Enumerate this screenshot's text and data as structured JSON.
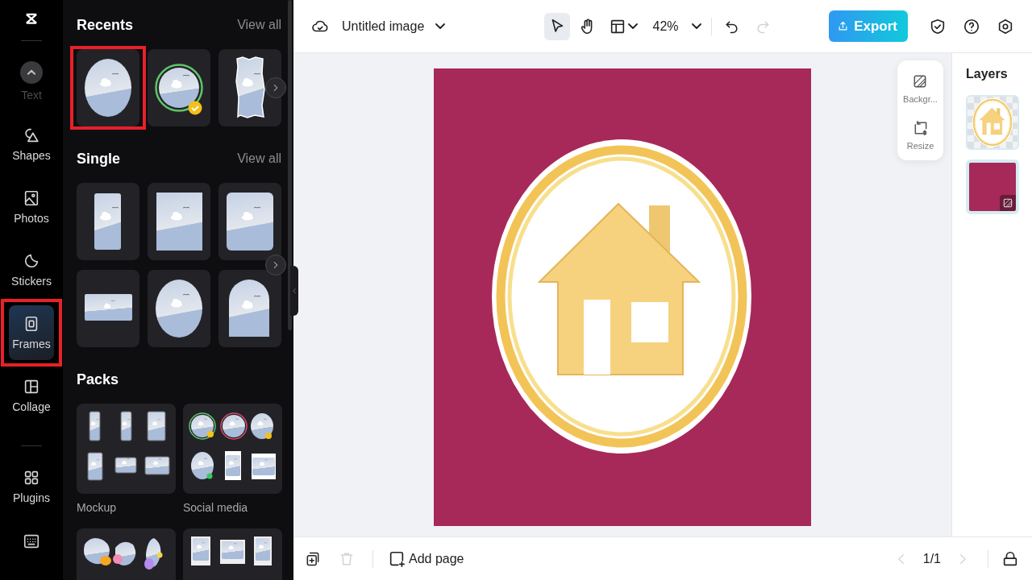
{
  "rail": {
    "groups": [
      {
        "items": [
          {
            "label": "Text",
            "kind": "text",
            "dimmed": true,
            "selected": false,
            "highlighted": false
          },
          {
            "label": "Shapes",
            "kind": "shapes",
            "dimmed": false,
            "selected": false,
            "highlighted": false
          },
          {
            "label": "Photos",
            "kind": "photos",
            "dimmed": false,
            "selected": false,
            "highlighted": false
          },
          {
            "label": "Stickers",
            "kind": "stickers",
            "dimmed": false,
            "selected": false,
            "highlighted": false
          },
          {
            "label": "Frames",
            "kind": "frames",
            "dimmed": false,
            "selected": true,
            "highlighted": true
          },
          {
            "label": "Collage",
            "kind": "collage",
            "dimmed": false,
            "selected": false,
            "highlighted": false
          }
        ]
      },
      {
        "items": [
          {
            "label": "Plugins",
            "kind": "plugins",
            "dimmed": false,
            "selected": false,
            "highlighted": false
          }
        ]
      }
    ]
  },
  "panel": {
    "sections": [
      {
        "title": "Recents",
        "link": "View all",
        "thumbs": [
          {
            "kind": "oval",
            "highlighted": true
          },
          {
            "kind": "ring-check",
            "highlighted": false
          },
          {
            "kind": "torn",
            "highlighted": false
          }
        ]
      },
      {
        "title": "Single",
        "link": "View all",
        "thumbs": [
          {
            "kind": "tall-rect",
            "highlighted": false
          },
          {
            "kind": "rect",
            "highlighted": false
          },
          {
            "kind": "rounded-rect",
            "highlighted": false
          },
          {
            "kind": "wide-rect",
            "highlighted": false
          },
          {
            "kind": "oval",
            "highlighted": false
          },
          {
            "kind": "arch",
            "highlighted": false
          }
        ]
      }
    ],
    "packs": {
      "title": "Packs",
      "items": [
        {
          "kind": "mockup",
          "label": "Mockup"
        },
        {
          "kind": "social",
          "label": "Social media"
        },
        {
          "kind": "blobs"
        },
        {
          "kind": "polaroid"
        }
      ]
    }
  },
  "top_bar": {
    "title": "Untitled image",
    "tools": [
      {
        "kind": "pointer",
        "selected": true
      },
      {
        "kind": "hand",
        "selected": false
      },
      {
        "kind": "layout",
        "selected": false
      }
    ],
    "zoom": "42%",
    "history": [
      {
        "kind": "undo",
        "disabled": false
      },
      {
        "kind": "redo",
        "disabled": true
      }
    ],
    "export": "Export"
  },
  "side_tools": [
    {
      "kind": "background",
      "label": "Backgr..."
    },
    {
      "kind": "resize",
      "label": "Resize"
    }
  ],
  "layers": {
    "title": "Layers",
    "items": [
      {
        "kind": "image"
      },
      {
        "kind": "background"
      }
    ]
  },
  "bottom_bar": {
    "actions": [
      {
        "kind": "duplicate",
        "disabled": false
      },
      {
        "kind": "delete",
        "disabled": true
      }
    ],
    "add_page": "Add page",
    "pager": {
      "label": "1/1",
      "prev_disabled": true,
      "next_disabled": true
    }
  }
}
